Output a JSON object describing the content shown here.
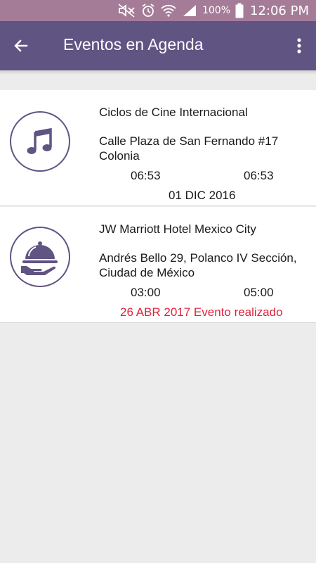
{
  "status_bar": {
    "battery": "100%",
    "time": "12:06 PM",
    "icons": [
      "mute-icon",
      "alarm-icon",
      "wifi-icon",
      "signal-icon",
      "battery-icon"
    ]
  },
  "app_bar": {
    "title": "Eventos en Agenda",
    "back_icon": "arrow-back-icon",
    "menu_icon": "more-vert-icon",
    "color": "#5f5482"
  },
  "events": [
    {
      "icon": "music-note-icon",
      "name": "Ciclos de Cine Internacional",
      "address": "Calle Plaza de San Fernando #17 Colonia",
      "start": "06:53",
      "end": "06:53",
      "date": "01 DIC 2016",
      "status": ""
    },
    {
      "icon": "restaurant-cloche-icon",
      "name": "JW Marriott Hotel Mexico City",
      "address": "Andrés Bello 29, Polanco IV Sección, Ciudad de México",
      "start": "03:00",
      "end": "05:00",
      "date": "26 ABR 2017 Evento realizado",
      "status_color": "#e3213b"
    }
  ]
}
